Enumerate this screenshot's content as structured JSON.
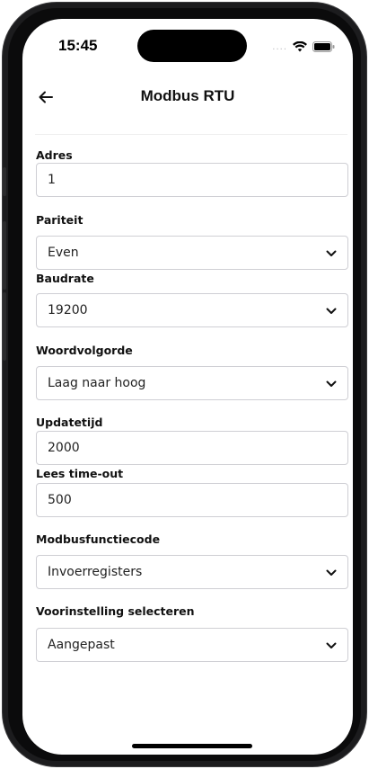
{
  "status_bar": {
    "time": "15:45",
    "signal_dots": "....",
    "icons": [
      "wifi-icon",
      "battery-icon"
    ]
  },
  "nav": {
    "back_icon": "arrow-left-icon",
    "title": "Modbus RTU"
  },
  "form": {
    "adres": {
      "label": "Adres",
      "value": "1"
    },
    "pariteit": {
      "label": "Pariteit",
      "value": "Even"
    },
    "baudrate": {
      "label": "Baudrate",
      "value": "19200"
    },
    "woordvolgorde": {
      "label": "Woordvolgorde",
      "value": "Laag naar hoog"
    },
    "updatetijd": {
      "label": "Updatetijd",
      "value": "2000"
    },
    "lees_timeout": {
      "label": "Lees time-out",
      "value": "500"
    },
    "modbusfunctiecode": {
      "label": "Modbusfunctiecode",
      "value": "Invoerregisters"
    },
    "voorinstelling": {
      "label": "Voorinstelling selecteren",
      "value": "Aangepast"
    }
  },
  "colors": {
    "text": "#111111",
    "border": "#cfcfd4",
    "background": "#ffffff"
  }
}
